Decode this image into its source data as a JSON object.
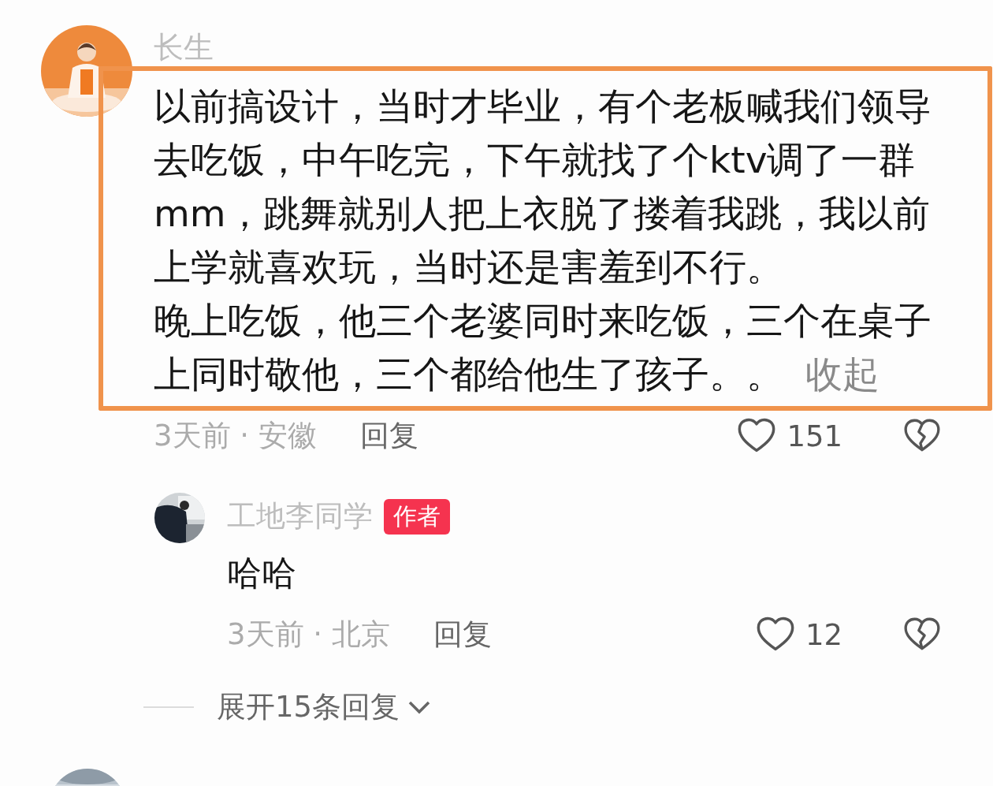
{
  "comment": {
    "author": "长生",
    "paragraphs": [
      "以前搞设计，当时才毕业，有个老板喊我们领导去吃饭，中午吃完，下午就找了个ktv调了一群mm，跳舞就别人把上衣脱了搂着我跳，我以前上学就喜欢玩，当时还是害羞到不行。",
      "晚上吃饭，他三个老婆同时来吃饭，三个在桌子上同时敬他，三个都给他生了孩子。。"
    ],
    "collapse_link": "收起",
    "meta": "3天前 · 安徽",
    "reply_label": "回复",
    "likes": "151"
  },
  "reply": {
    "author": "工地李同学",
    "badge": "作者",
    "text": "哈哈",
    "meta": "3天前 · 北京",
    "reply_label": "回复",
    "likes": "12"
  },
  "expand": {
    "label": "展开15条回复"
  }
}
